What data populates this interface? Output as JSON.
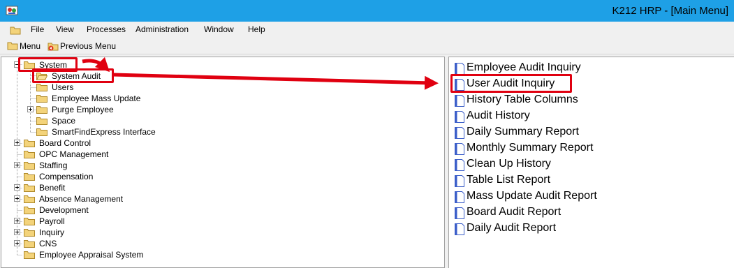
{
  "window": {
    "title": "K212 HRP - [Main Menu]"
  },
  "menubar": {
    "items": [
      "File",
      "View",
      "Processes",
      "Administration",
      "Window",
      "Help"
    ]
  },
  "toolbar": {
    "menu_label": "Menu",
    "previous_menu_label": "Previous Menu"
  },
  "tree": {
    "system": "System",
    "system_audit": "System Audit",
    "children": [
      "Users",
      "Employee Mass Update",
      "Purge Employee",
      "Space",
      "SmartFindExpress Interface"
    ],
    "roots": [
      "Board Control",
      "OPC Management",
      "Staffing",
      "Compensation",
      "Benefit",
      "Absence Management",
      "Development",
      "Payroll",
      "Inquiry",
      "CNS",
      "Employee Appraisal System"
    ]
  },
  "list": {
    "items": [
      "Employee Audit Inquiry",
      "User Audit Inquiry",
      "History Table Columns",
      "Audit History",
      "Daily Summary Report",
      "Monthly Summary Report",
      "Clean Up History",
      "Table List Report",
      "Mass Update Audit Report",
      "Board Audit Report",
      "Daily Audit Report"
    ]
  },
  "colors": {
    "titlebar": "#1ea0e6",
    "annotation": "#e00010",
    "folder": "#f3d37a"
  }
}
